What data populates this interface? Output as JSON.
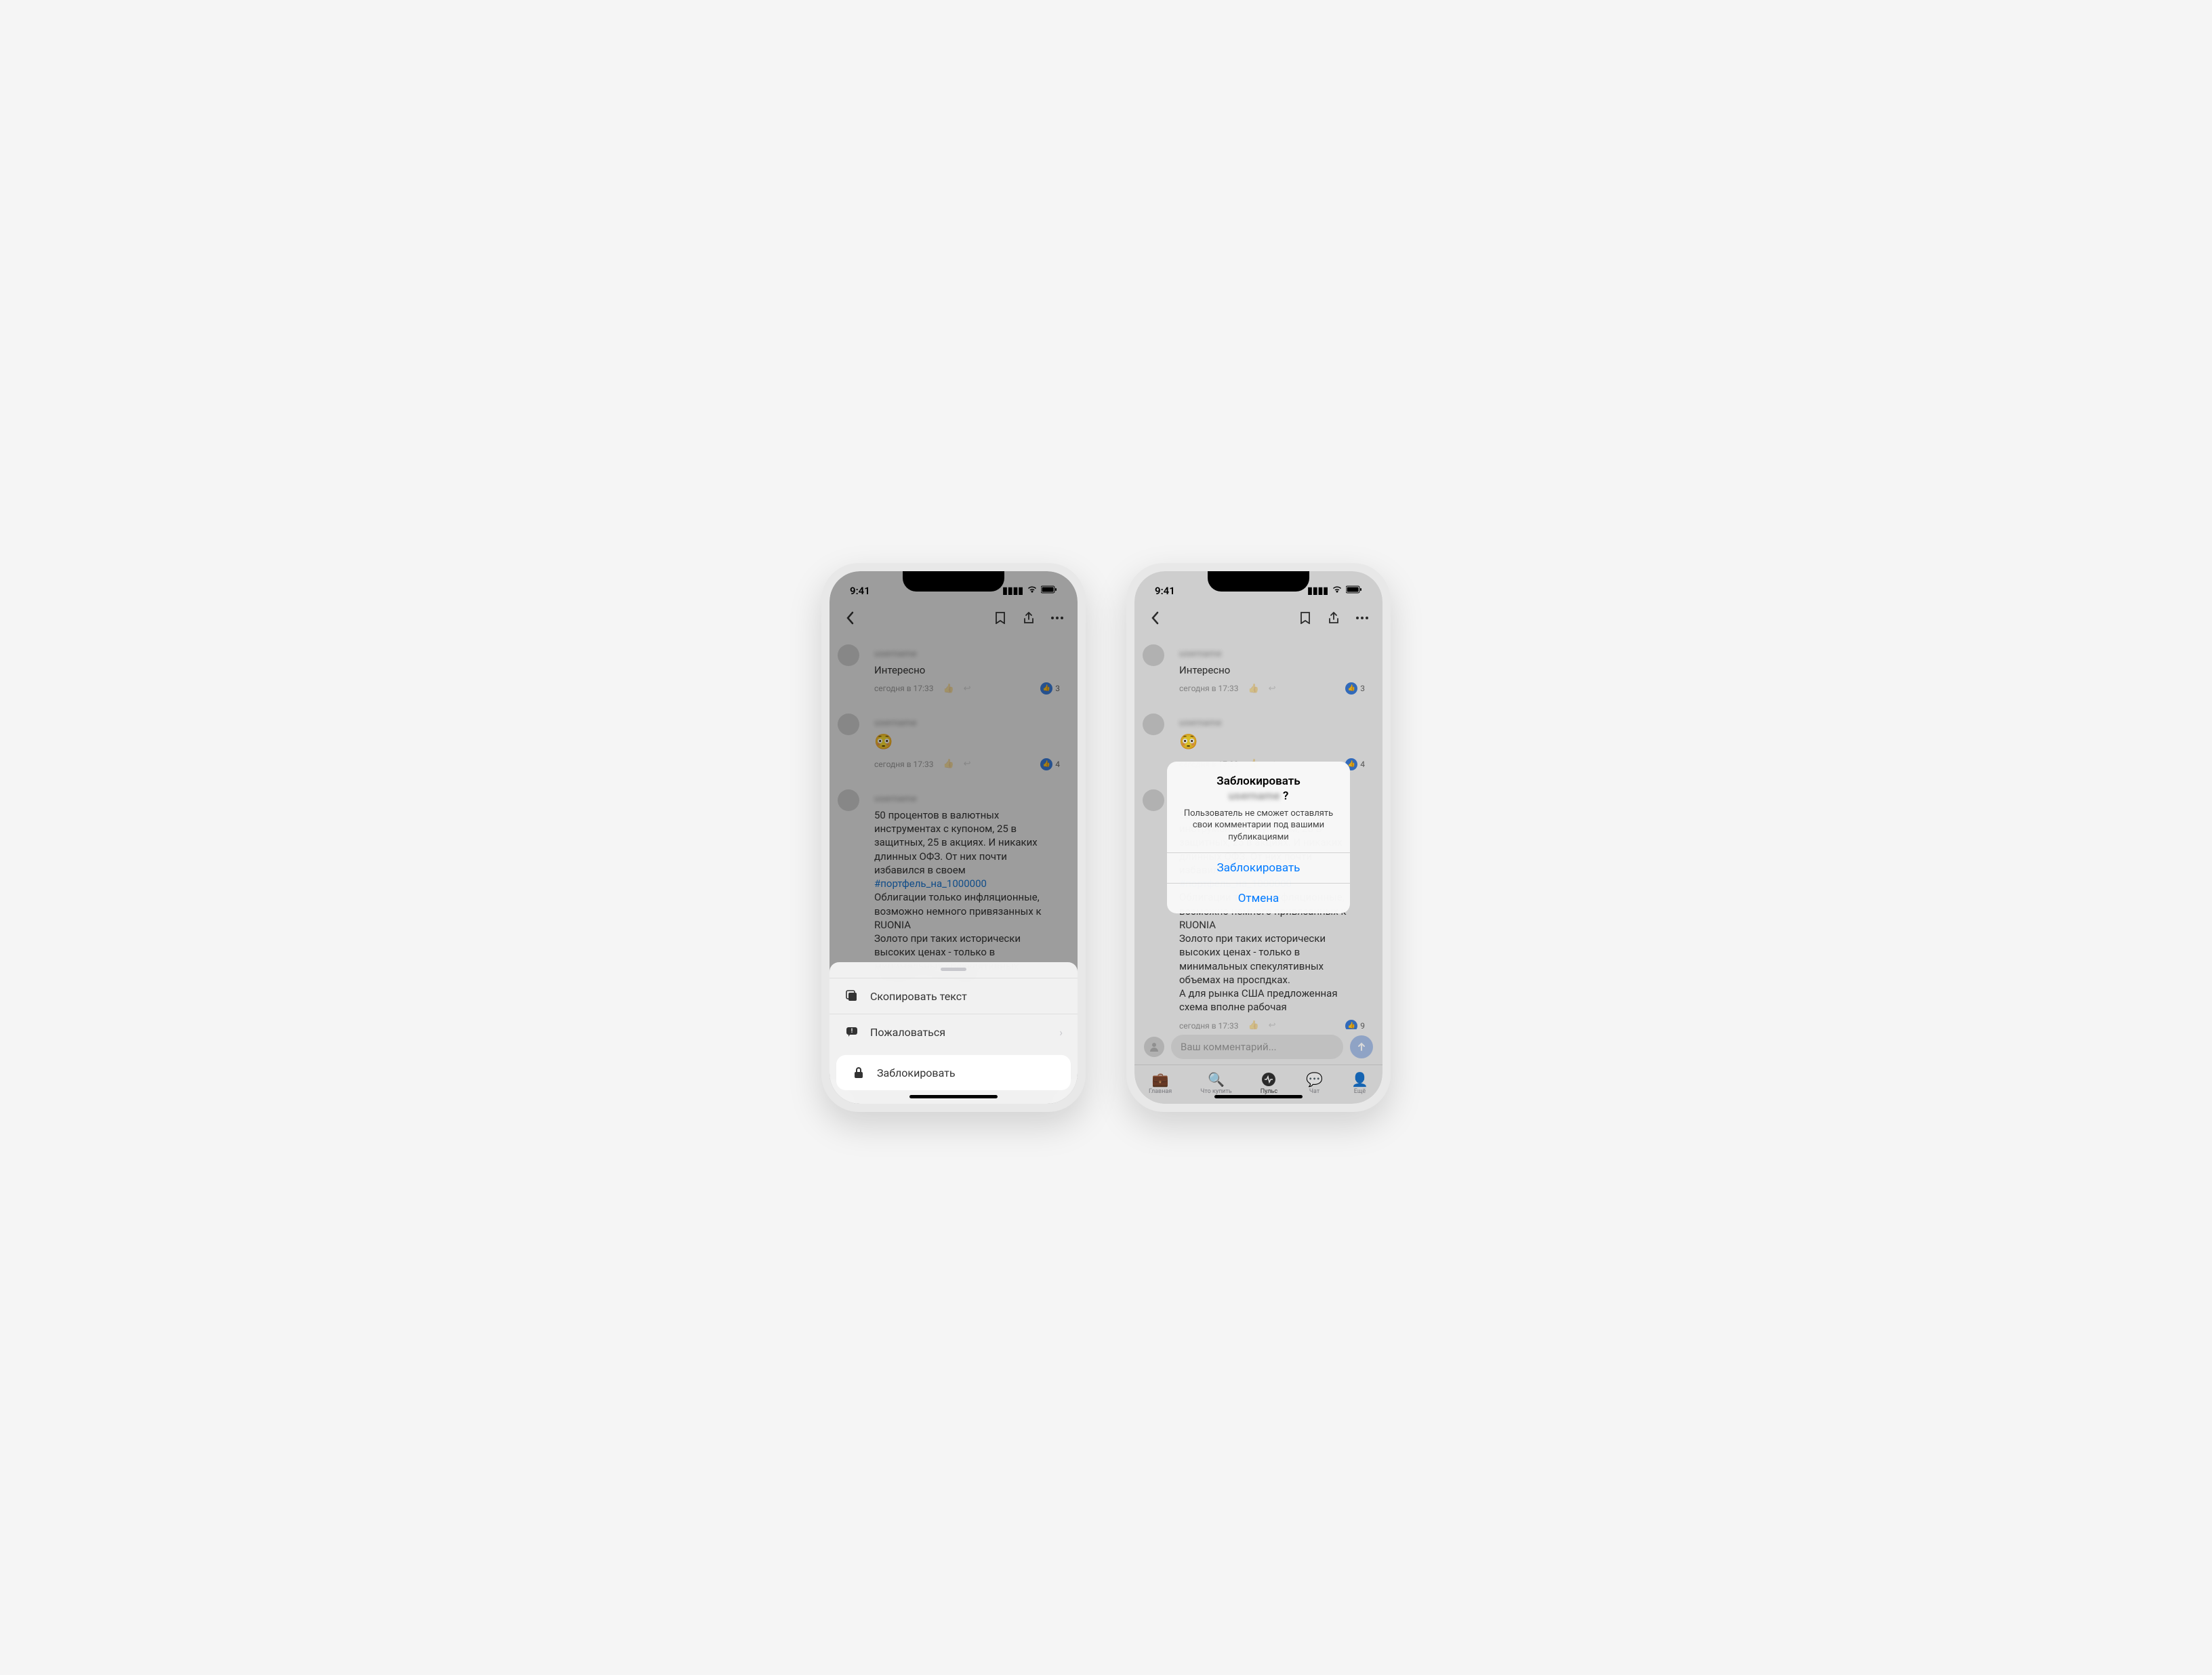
{
  "status": {
    "time": "9:41"
  },
  "comments": {
    "c1": {
      "text": "Интересно",
      "time": "сегодня в 17:33",
      "likes": "3"
    },
    "c2": {
      "time": "сегодня в 17:33",
      "likes": "4"
    },
    "c3": {
      "text_part1": "50 процентов в валютных инструментах с купоном, 25 в защитных, 25 в акциях. И никаких длинных ОФЗ. От них почти избавился в своем",
      "hashtag": "#портфель_на_1000000",
      "text_part2": "Облигации только инфляционные, возможно немного привязанных к RUONIA",
      "text_part3": "Золото при таких исторически высоких ценах - только в минимальных спекулятивных объемах на проспдках",
      "text_part3_full": "Золото при таких исторически высоких ценах - только в минимальных спекулятивных объемах на проспдках.",
      "text_part4": "А для рынка США предложенная схема вполне рабочая",
      "time": "сегодня в 17:33",
      "likes": "9"
    }
  },
  "action_sheet": {
    "copy": "Скопировать текст",
    "report": "Пожаловаться",
    "block": "Заблокировать"
  },
  "alert": {
    "title": "Заблокировать",
    "title_suffix": "?",
    "body": "Пользователь не сможет оставлять свои комментарии под вашими публикациями",
    "confirm": "Заблокировать",
    "cancel": "Отмена"
  },
  "comment_input": {
    "placeholder": "Ваш комментарий..."
  },
  "tabs": {
    "home": "Главная",
    "buy": "Что купить",
    "pulse": "Пульс",
    "chat": "Чат",
    "more": "Ещё"
  }
}
